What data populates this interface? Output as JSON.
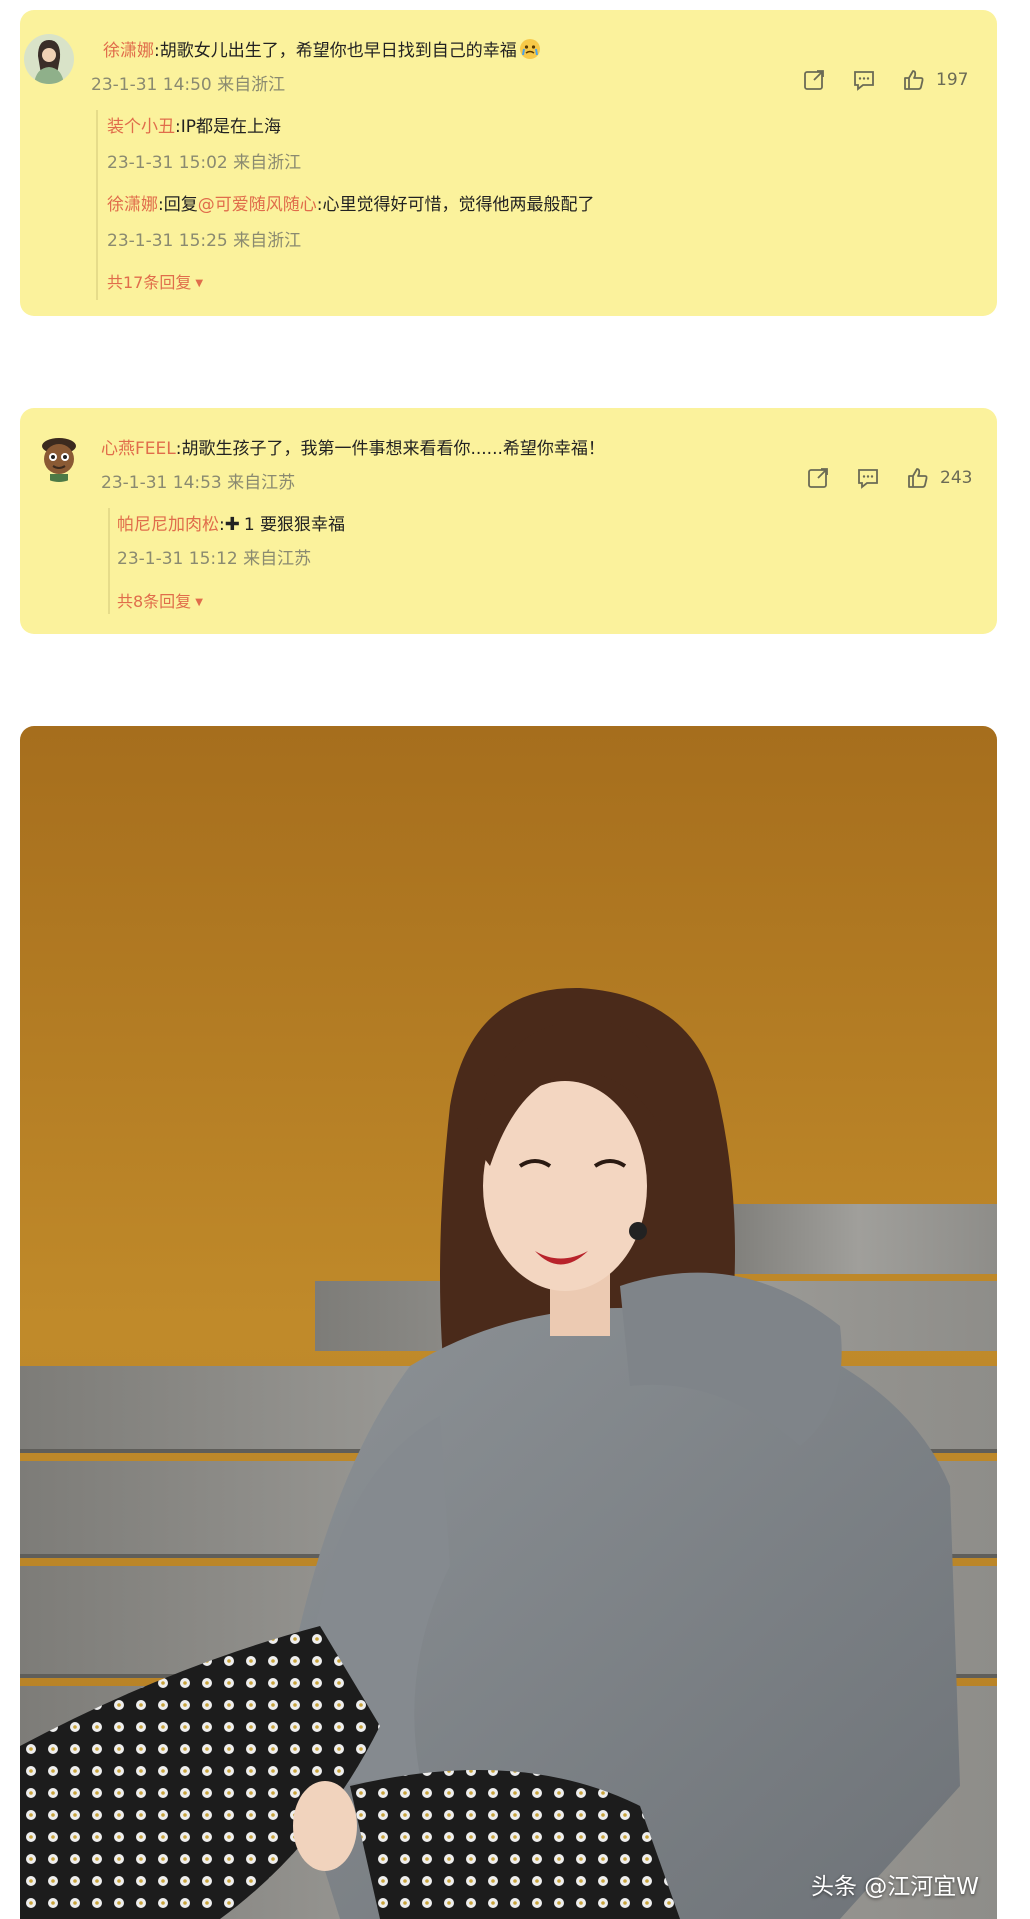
{
  "comments": [
    {
      "username": "徐潇娜",
      "text": ":胡歌女儿出生了，希望你也早日找到自己的幸福",
      "emoji": "cry-emoji",
      "time": "23-1-31 14:50",
      "location": "来自浙江",
      "likes": "197",
      "replies": [
        {
          "username": "装个小丑",
          "text": ":IP都是在上海",
          "time": "23-1-31 15:02",
          "location": "来自浙江"
        },
        {
          "username": "徐潇娜",
          "reply_prefix": ":回复",
          "at": "@可爱随风随心",
          "text": ":心里觉得好可惜，觉得他两最般配了",
          "time": "23-1-31 15:25",
          "location": "来自浙江"
        }
      ],
      "more_replies": "共17条回复"
    },
    {
      "username": "心燕FEEL",
      "text": ":胡歌生孩子了，我第一件事想来看看你......希望你幸福！",
      "time": "23-1-31 14:53",
      "location": "来自江苏",
      "likes": "243",
      "replies": [
        {
          "username": "帕尼尼加肉松",
          "plus": "✚",
          "text": "1 要狠狠幸福",
          "time": "23-1-31 15:12",
          "location": "来自江苏"
        }
      ],
      "more_replies": "共8条回复"
    }
  ],
  "icons": [
    "share-icon",
    "comment-icon",
    "like-icon"
  ],
  "watermark": "头条 @江河宜W",
  "colors": {
    "card": "#fbf29c",
    "accent": "#e06d4b",
    "meta": "#8a8a70"
  }
}
